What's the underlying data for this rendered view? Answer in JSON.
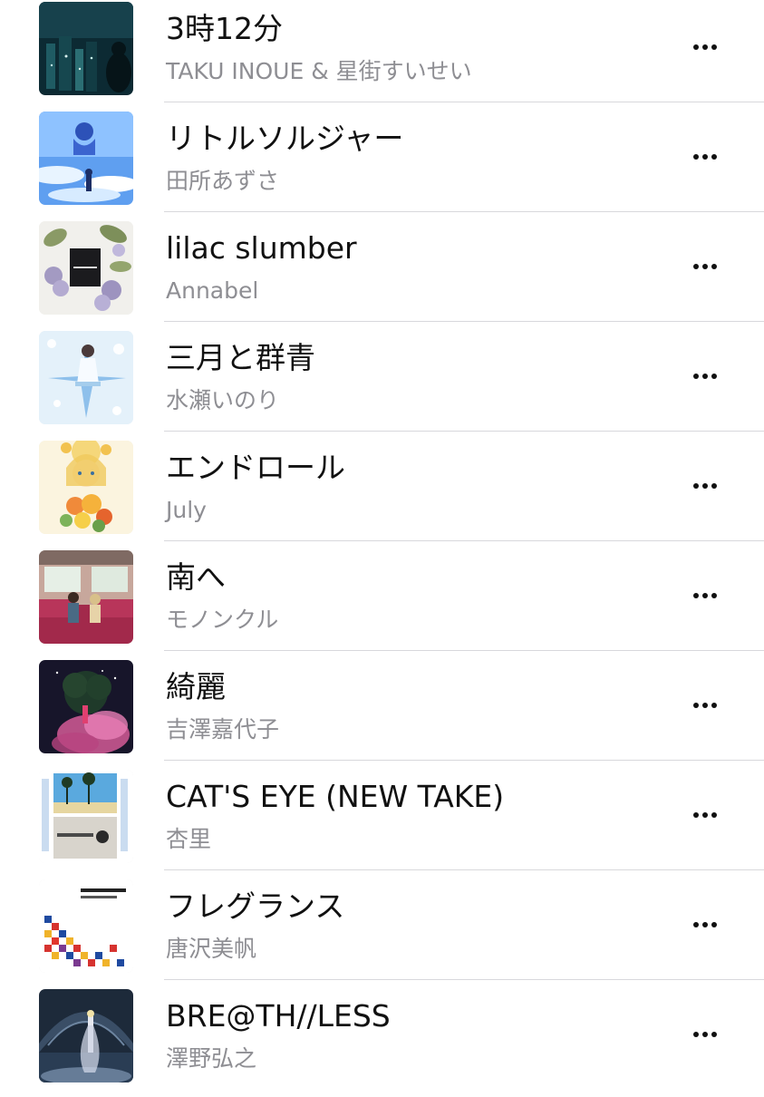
{
  "tracks": [
    {
      "title": "3時12分",
      "artist": "TAKU INOUE & 星街すいせい",
      "artwork": "night-city-artwork"
    },
    {
      "title": "リトルソルジャー",
      "artist": "田所あずさ",
      "artwork": "blue-sky-artwork"
    },
    {
      "title": "lilac slumber",
      "artist": "Annabel",
      "artwork": "lilac-flowers-artwork"
    },
    {
      "title": "三月と群青",
      "artist": "水瀬いのり",
      "artwork": "light-blue-artwork"
    },
    {
      "title": "エンドロール",
      "artist": "July",
      "artwork": "flower-bouquet-artwork"
    },
    {
      "title": "南へ",
      "artist": "モノンクル",
      "artwork": "train-interior-artwork"
    },
    {
      "title": "綺麗",
      "artist": "吉澤嘉代子",
      "artwork": "pink-smoke-artwork"
    },
    {
      "title": "CAT'S EYE (NEW TAKE)",
      "artist": "杏里",
      "artwork": "palm-trees-artwork"
    },
    {
      "title": "フレグランス",
      "artist": "唐沢美帆",
      "artwork": "pixel-mosaic-artwork"
    },
    {
      "title": "BRE@TH//LESS",
      "artist": "澤野弘之",
      "artwork": "dark-arch-artwork"
    }
  ],
  "more_icon": "ellipsis-icon",
  "colors": {
    "title": "#111111",
    "artist": "#8e8e93",
    "separator": "#d8d8dc"
  }
}
